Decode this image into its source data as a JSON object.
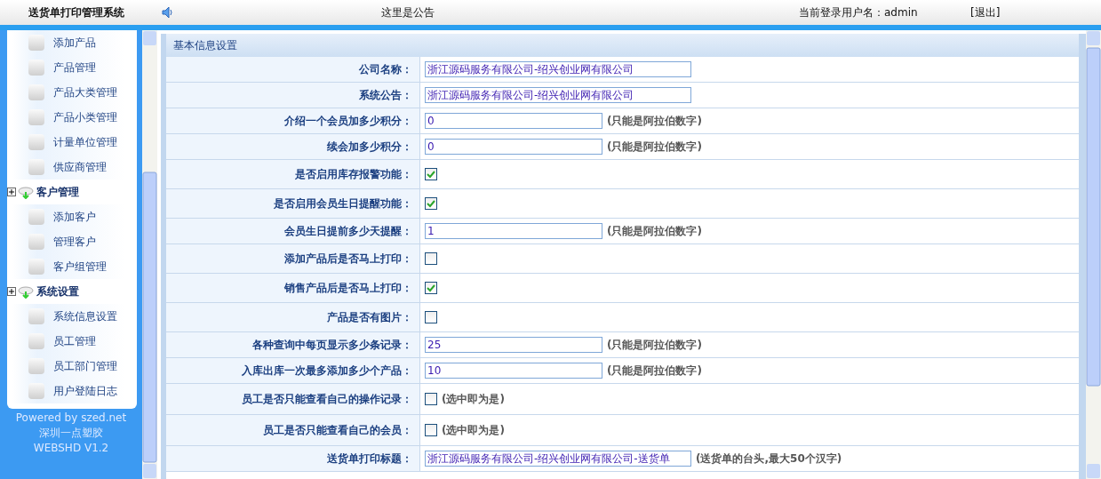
{
  "header": {
    "title": "送货单打印管理系统",
    "notice": "这里是公告",
    "user_label": "当前登录用户名：admin",
    "logout": "[退出]"
  },
  "sidebar": {
    "groups": [
      {
        "items": [
          "添加产品",
          "产品管理",
          "产品大类管理",
          "产品小类管理",
          "计量单位管理",
          "供应商管理"
        ]
      },
      {
        "title": "客户管理",
        "items": [
          "添加客户",
          "管理客户",
          "客户组管理"
        ]
      },
      {
        "title": "系统设置",
        "items": [
          "系统信息设置",
          "员工管理",
          "员工部门管理",
          "用户登陆日志"
        ]
      }
    ],
    "footer": [
      "Powered by szed.net",
      "深圳一点塑胶",
      "WEBSHD V1.2"
    ]
  },
  "form": {
    "title": "基本信息设置",
    "rows": [
      {
        "kind": "text",
        "label": "公司名称：",
        "value": "浙江源码服务有限公司-绍兴创业网有限公司"
      },
      {
        "kind": "text",
        "label": "系统公告：",
        "value": "浙江源码服务有限公司-绍兴创业网有限公司"
      },
      {
        "kind": "text",
        "label": "介绍一个会员加多少积分：",
        "value": "0",
        "hint": "(只能是阿拉伯数字)"
      },
      {
        "kind": "text",
        "label": "续会加多少积分：",
        "value": "0",
        "hint": "(只能是阿拉伯数字)"
      },
      {
        "kind": "check",
        "label": "是否启用库存报警功能：",
        "checked": true
      },
      {
        "kind": "check",
        "label": "是否启用会员生日提醒功能：",
        "checked": true
      },
      {
        "kind": "text",
        "label": "会员生日提前多少天提醒：",
        "value": "1",
        "hint": "(只能是阿拉伯数字)"
      },
      {
        "kind": "check",
        "label": "添加产品后是否马上打印：",
        "checked": false
      },
      {
        "kind": "check",
        "label": "销售产品后是否马上打印：",
        "checked": true
      },
      {
        "kind": "check",
        "label": "产品是否有图片：",
        "checked": false
      },
      {
        "kind": "text",
        "label": "各种查询中每页显示多少条记录：",
        "value": "25",
        "hint": "(只能是阿拉伯数字)"
      },
      {
        "kind": "text",
        "label": "入库出库一次最多添加多少个产品：",
        "value": "10",
        "hint": "(只能是阿拉伯数字)"
      },
      {
        "kind": "check",
        "label": "员工是否只能查看自己的操作记录：",
        "checked": false,
        "hint": "(选中即为是)"
      },
      {
        "kind": "check",
        "label": "员工是否只能查看自己的会员：",
        "checked": false,
        "hint": "(选中即为是)"
      },
      {
        "kind": "text",
        "label": "送货单打印标题：",
        "value": "浙江源码服务有限公司-绍兴创业网有限公司-送货单",
        "hint": "(送货单的台头,最大50个汉字)"
      }
    ]
  }
}
